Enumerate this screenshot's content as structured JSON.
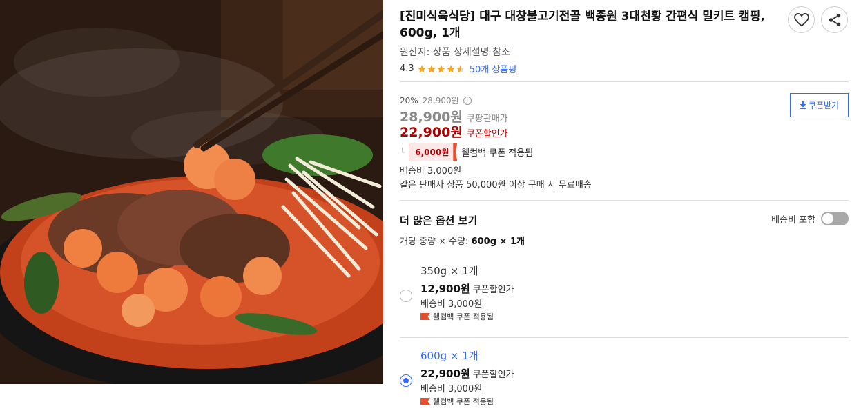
{
  "product": {
    "title": "[진미식육식당] 대구 대창불고기전골 백종원 3대천황 간편식 밀키트 캠핑, 600g, 1개",
    "origin": "원산지: 상품 상세설명 참조",
    "rating": "4.3",
    "rating_value": 4.3,
    "review_count": "50개 상품평"
  },
  "icons": {
    "wishlist": "heart-icon",
    "share": "share-icon",
    "info": "info-icon",
    "download": "download-icon"
  },
  "price": {
    "discount_rate": "20%",
    "original": "28,900원",
    "sale_price": "28,900원",
    "sale_label": "쿠팡판매가",
    "coupon_price": "22,900원",
    "coupon_label": "쿠폰할인가",
    "coupon_button": "쿠폰받기",
    "welcome_amount": "6,000원",
    "welcome_label": "웰컴백 쿠폰 적용됨",
    "shipping": "배송비 3,000원",
    "free_shipping": "같은 판매자 상품 50,000원 이상 구매 시 무료배송"
  },
  "options": {
    "heading": "더 많은 옵션 보기",
    "include_shipping_label": "배송비 포함",
    "include_shipping_on": false,
    "summary_label": "개당 중량 × 수량:",
    "summary_value": "600g × 1개",
    "items": [
      {
        "name": "350g × 1개",
        "price": "12,900원",
        "price_label": "쿠폰할인가",
        "shipping": "배송비 3,000원",
        "coupon": "웰컴백 쿠폰 적용됨",
        "selected": false
      },
      {
        "name": "600g × 1개",
        "price": "22,900원",
        "price_label": "쿠폰할인가",
        "shipping": "배송비 3,000원",
        "coupon": "웰컴백 쿠폰 적용됨",
        "selected": true
      }
    ]
  },
  "colors": {
    "accent_blue": "#346aff",
    "price_red": "#ae0000",
    "coupon_flag": "#e4502f",
    "star": "#f5a623"
  }
}
